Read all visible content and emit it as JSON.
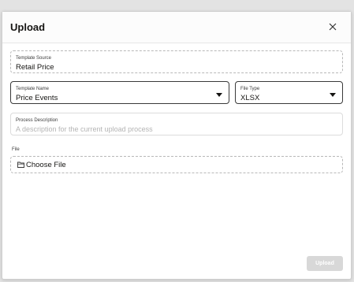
{
  "dialog": {
    "title": "Upload",
    "close_icon": "close-icon"
  },
  "template_source": {
    "label": "Template Source",
    "value": "Retail Price"
  },
  "template_name": {
    "label": "Template Name",
    "value": "Price Events",
    "icon": "caret-down-icon"
  },
  "file_type": {
    "label": "File Type",
    "value": "XLSX",
    "icon": "caret-down-icon"
  },
  "process_description": {
    "label": "Process Description",
    "placeholder": "A description for the current upload process"
  },
  "file": {
    "label": "File",
    "choose_label": "Choose File",
    "icon": "folder-icon"
  },
  "footer": {
    "upload_label": "Upload"
  }
}
